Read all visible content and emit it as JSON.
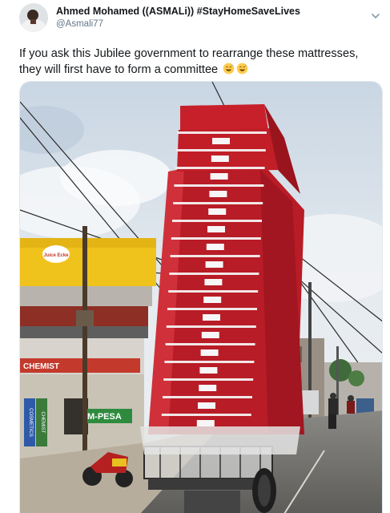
{
  "tweet": {
    "author": {
      "display_name": "Ahmed Mohamed ((ASMALi)) #StayHomeSaveLives",
      "handle": "@Asmali77"
    },
    "text_line_1": "If you ask this Jubilee government to rearrange these mattresses,",
    "text_line_2": "they will first have to form a committee",
    "emojis": [
      "grinning-sweat-emoji",
      "grinning-sweat-emoji"
    ],
    "menu_icon": "chevron-down-icon"
  },
  "photo": {
    "description_icon": "photo",
    "shop_sign_text": "Juice Ecke",
    "storefront_text": "CHEMIST",
    "mpesa_text": "M-PESA",
    "vertical_sign_1": "COSMETICS",
    "vertical_sign_2": "CHEMIST",
    "colors": {
      "mattress_red": "#c8202a",
      "sky": "#dfe6ee",
      "road": "#6f6e6c"
    }
  }
}
